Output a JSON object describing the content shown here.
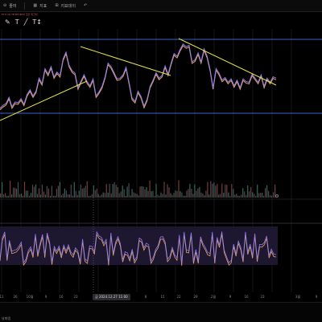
{
  "toolbar": {
    "zoom_label": "줄여",
    "indicator_label": "지표",
    "template_label": "지표데이",
    "left_indicator": "L",
    "info_line": "ETH·1D·TB·BTCBTD·코인 피크차 ",
    "tools": {
      "pencil": "✎",
      "text": "T",
      "line": "╱",
      "measure": "T↕"
    }
  },
  "x_axis": {
    "labels": [
      "11",
      "26",
      "10월",
      "9",
      "16",
      "23",
      "8",
      "15",
      "22",
      "29",
      "2월",
      "9",
      "16",
      "23",
      "3월",
      "9"
    ],
    "cursor_date": "금 2024.12.27 11:00"
  },
  "bottom": {
    "label": "날짜맵"
  },
  "colors": {
    "background": "#000000",
    "price_purple": "#8e7cf0",
    "price_orange": "#e8a366",
    "trendline": "#e6e24b",
    "level_line": "#3a63c8",
    "osc_band": "#1d1730"
  },
  "chart_data": {
    "type": "line",
    "series": [
      {
        "values": [
          18,
          22,
          25,
          34,
          20,
          27,
          26,
          32,
          24,
          38,
          45,
          36,
          43,
          62,
          54,
          76,
          68,
          79,
          64,
          71,
          66,
          90,
          100,
          81,
          73,
          69,
          48,
          58,
          67,
          57,
          51,
          61,
          36,
          42,
          50,
          64,
          84,
          79,
          70,
          61,
          62,
          67,
          78,
          56,
          33,
          28,
          43,
          35,
          21,
          31,
          50,
          59,
          70,
          62,
          66,
          80,
          68,
          84,
          98,
          94,
          104,
          112,
          108,
          110,
          86,
          89,
          99,
          86,
          105,
          94,
          75,
          48,
          76,
          69,
          59,
          63,
          56,
          61,
          51,
          59,
          48,
          61,
          57,
          56,
          68,
          62,
          56,
          67,
          50,
          62,
          56,
          64,
          62
        ]
      },
      {
        "values": [
          0.19,
          0.8,
          0.98,
          0.2,
          0.73,
          0.41,
          0.43,
          0.46,
          0.55,
          0.68,
          0.07,
          0.17,
          0.43,
          0.54,
          0.29,
          0.92,
          0.32,
          0.64,
          0.91,
          0.29,
          0.95,
          0.68,
          0.08,
          0.55,
          0.41,
          0.56,
          0.28,
          0.59,
          0.42,
          0.6,
          0.39,
          0.3,
          0.51,
          0.42,
          0.09,
          0.77,
          0.18,
          0.12,
          0.57,
          0.55,
          0.4,
          0.98,
          0.86,
          0.82,
          0.64,
          0.76,
          0.06,
          0.95,
          0.35,
          0.68,
          0.84,
          0.63,
          0.16,
          0.39,
          0.36,
          0.19,
          0.47,
          0.13,
          0.25,
          0.8,
          0.75,
          0.51,
          0.65,
          0.6,
          0.12,
          0.24,
          0.47,
          0.58,
          0.83,
          0.84,
          0.68,
          0.17,
          0.26,
          0.52,
          0.31,
          0.21,
          0.89,
          0.05,
          0.98,
          0.44,
          0.43,
          0.96,
          0.11,
          0.46,
          0.12,
          0.84,
          0.64,
          0.52,
          0.37,
          0.34,
          0.98,
          0.12,
          0.82,
          0.59,
          0.99,
          0.44,
          0.25,
          0.07,
          0.14,
          0.62,
          0.33,
          0.71,
          0.53,
          0.16,
          0.98,
          0.38,
          0.62,
          0.27,
          0.93,
          0.17,
          0.61,
          0.6,
          0.67,
          0.86,
          0.28,
          0.47,
          0.32,
          0.31
        ]
      }
    ],
    "volume": [
      0.38,
      0.93,
      0.31,
      0.41,
      0.06,
      0.14,
      0.98,
      0.3,
      0.72,
      0.71,
      0.67,
      0.93,
      0.34,
      0.38,
      0.14,
      0.94,
      0.57,
      0.58,
      0.13,
      0.43,
      0.84,
      0.76,
      0.85,
      0.36,
      0.69,
      0.28,
      0.84,
      0.52,
      0.28,
      0.78,
      0.68,
      0.06,
      0.79,
      0.07,
      0.11,
      0.66,
      0.79,
      0.93,
      0.22,
      0.39,
      0.68,
      0.58,
      0.32,
      0.3,
      0.84,
      0.15,
      0.93,
      0.56,
      0.24,
      0.57,
      0.84,
      0.67,
      0.7,
      0.79,
      0.96,
      0.04,
      0.1,
      0.34,
      0.81,
      0.6,
      0.67,
      0.36,
      0.11,
      0.3,
      0.47,
      0.43,
      0.86,
      0.45,
      0.87,
      0.4,
      0.86,
      0.92,
      0.83,
      0.74,
      0.41,
      0.53,
      0.8,
      0.64,
      0.03,
      0.76,
      0.89,
      0.17,
      0.66,
      0.48,
      0.41,
      0.36,
      0.17,
      0.76,
      0.78,
      0.76,
      0.64,
      0.74,
      0.56,
      0.98,
      0.54,
      0.56,
      0.05,
      0.87,
      0.27,
      0.02,
      0.47,
      0.37,
      0.94,
      0.29,
      0.85,
      0.73,
      0.41,
      0.26,
      0.44,
      0.58,
      0.56,
      0.99,
      0.55,
      0.47,
      0.11,
      0.09,
      0.57,
      0.66,
      0.87,
      0.67,
      0.37,
      0.85,
      0.56,
      0.69,
      0.75,
      0.46,
      0.4,
      0.19,
      0.57,
      0.93,
      0.29,
      0.96,
      0.87,
      0.91,
      0.8,
      0.86,
      0.28,
      0.36,
      0.88,
      0.45,
      0.84,
      0.83,
      0.47,
      0.04,
      0.86,
      0.66,
      0.28,
      0.37,
      0.11,
      0.06,
      0.27,
      0.7,
      0.53,
      0.24,
      0.81,
      0.54,
      0.75,
      0.48,
      0.36,
      0.06,
      0.84,
      0.42,
      0.44,
      0.44,
      0.07,
      0.7,
      0.82,
      0.56,
      0.2,
      0.1,
      0.48,
      0.85
    ],
    "grid": true
  }
}
